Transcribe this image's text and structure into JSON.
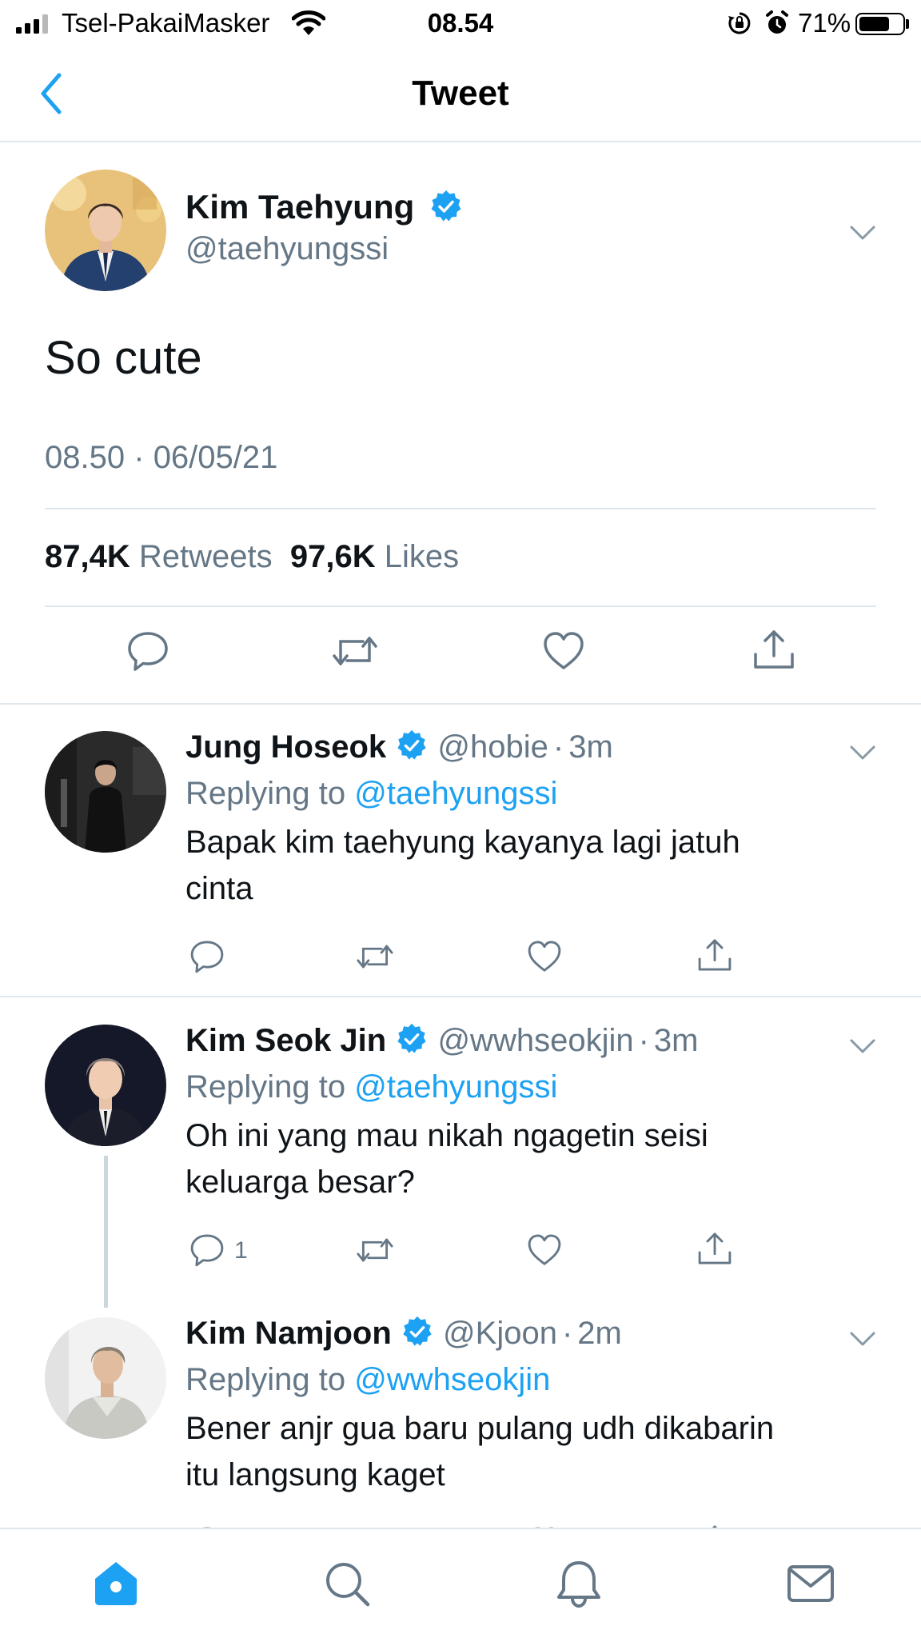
{
  "status_bar": {
    "carrier": "Tsel-PakaiMasker",
    "time": "08.54",
    "battery_percent": "71%",
    "battery_level": 0.71
  },
  "header": {
    "title": "Tweet",
    "back_icon": "chevron-left-icon"
  },
  "main_tweet": {
    "display_name": "Kim Taehyung",
    "handle": "@taehyungssi",
    "text": "So cute",
    "time": "08.50",
    "separator": "·",
    "date": "06/05/21",
    "retweets_count": "87,4K",
    "retweets_label": "Retweets",
    "likes_count": "97,6K",
    "likes_label": "Likes"
  },
  "replies": [
    {
      "display_name": "Jung Hoseok",
      "handle": "@hobie",
      "separator": "·",
      "time": "3m",
      "replying_prefix": "Replying to",
      "replying_to": "@taehyungssi",
      "text_line1": "Bapak kim taehyung kayanya lagi jatuh",
      "text_line2": "cinta",
      "reply_count": ""
    },
    {
      "display_name": "Kim Seok Jin",
      "handle": "@wwhseokjin",
      "separator": "·",
      "time": "3m",
      "replying_prefix": "Replying to",
      "replying_to": "@taehyungssi",
      "text_line1": "Oh ini yang mau nikah ngagetin seisi",
      "text_line2": "keluarga besar?",
      "reply_count": "1"
    },
    {
      "display_name": "Kim Namjoon",
      "handle": "@Kjoon",
      "separator": "·",
      "time": "2m",
      "replying_prefix": "Replying to",
      "replying_to": "@wwhseokjin",
      "text_line1": "Bener anjr gua baru pulang udh dikabarin",
      "text_line2": "itu langsung kaget",
      "reply_count": ""
    }
  ],
  "tab_bar": {
    "items": [
      "home-icon",
      "search-icon",
      "notifications-icon",
      "messages-icon"
    ],
    "active": "home-icon"
  },
  "colors": {
    "accent": "#1da1f2",
    "secondary_text": "#657786",
    "divider": "#e1e8ed"
  }
}
